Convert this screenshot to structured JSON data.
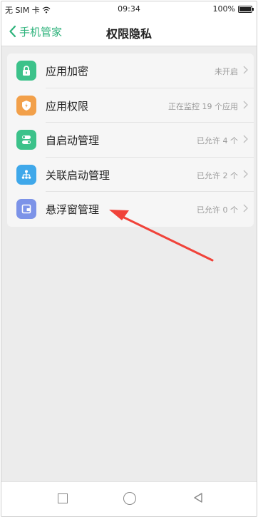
{
  "status_bar": {
    "carrier": "无 SIM 卡",
    "time": "09:34",
    "battery": "100%"
  },
  "nav": {
    "back_label": "手机管家",
    "title": "权限隐私"
  },
  "menu": [
    {
      "label": "应用加密",
      "value": "未开启",
      "icon": "lock-icon",
      "color": "#3cc28a"
    },
    {
      "label": "应用权限",
      "value": "正在监控 19 个应用",
      "icon": "shield-icon",
      "color": "#f2a04a"
    },
    {
      "label": "自启动管理",
      "value": "已允许 4 个",
      "icon": "toggle-icon",
      "color": "#3cc28a"
    },
    {
      "label": "关联启动管理",
      "value": "已允许 2 个",
      "icon": "network-icon",
      "color": "#3fa8ea"
    },
    {
      "label": "悬浮窗管理",
      "value": "已允许 0 个",
      "icon": "floating-window-icon",
      "color": "#7c93e8"
    }
  ],
  "colors": {
    "accent": "#2fb37c",
    "annotation": "#f0433a"
  },
  "bottom_nav": {
    "icons": [
      "recent-apps-icon",
      "home-icon",
      "back-icon"
    ]
  }
}
